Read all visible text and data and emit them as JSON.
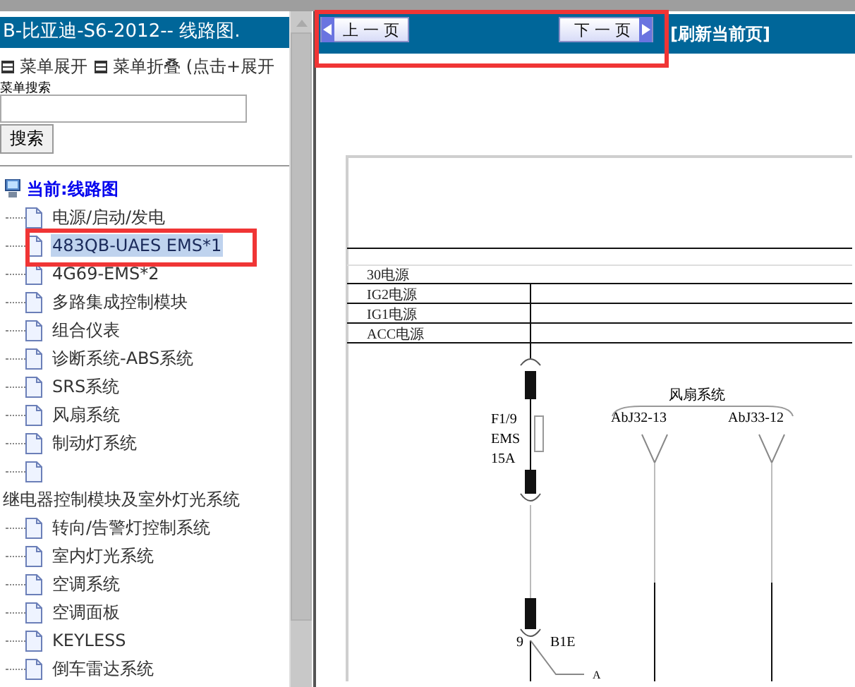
{
  "left_panel": {
    "title": "B-比亚迪-S6-2012-- 线路图.",
    "menu_links": [
      {
        "label": "菜单展开"
      },
      {
        "label": "菜单折叠 (点击+展开"
      }
    ],
    "search": {
      "label": "菜单搜索",
      "button": "搜索"
    },
    "tree": [
      {
        "kind": "root",
        "label": "当前:线路图",
        "children": [
          {
            "label": "电源/启动/发电",
            "selected": false
          },
          {
            "label": "483QB-UAES EMS*1",
            "selected": true
          },
          {
            "label": "4G69-EMS*2",
            "selected": false
          },
          {
            "label": "多路集成控制模块",
            "selected": false
          },
          {
            "label": "组合仪表",
            "selected": false
          },
          {
            "label": "诊断系统-ABS系统",
            "selected": false
          },
          {
            "label": "SRS系统",
            "selected": false
          },
          {
            "label": "风扇系统",
            "selected": false
          },
          {
            "label": "制动灯系统",
            "selected": false
          },
          {
            "selected": false
          }
        ]
      },
      {
        "kind": "folder",
        "label": "继电器控制模块及室外灯光系统",
        "children": [
          {
            "label": "转向/告警灯控制系统",
            "selected": false
          },
          {
            "label": "室内灯光系统",
            "selected": false
          },
          {
            "label": "空调系统",
            "selected": false
          },
          {
            "label": "空调面板",
            "selected": false
          },
          {
            "label": "KEYLESS",
            "selected": false
          },
          {
            "label": "倒车雷达系统",
            "selected": false
          }
        ]
      }
    ]
  },
  "toolbar": {
    "prev": "上 一 页",
    "next": "下 一 页",
    "refresh": "[刷新当前页]"
  },
  "diagram": {
    "rails": [
      "30电源",
      "IG2电源",
      "IG1电源",
      "ACC电源"
    ],
    "fuse": {
      "name": "F1/9",
      "circuit": "EMS",
      "rating": "15A"
    },
    "system": "风扇系统",
    "connectors": [
      "AbJ32-13",
      "AbJ33-12"
    ],
    "pin": "9",
    "splice": "B1E",
    "branch": "A"
  }
}
